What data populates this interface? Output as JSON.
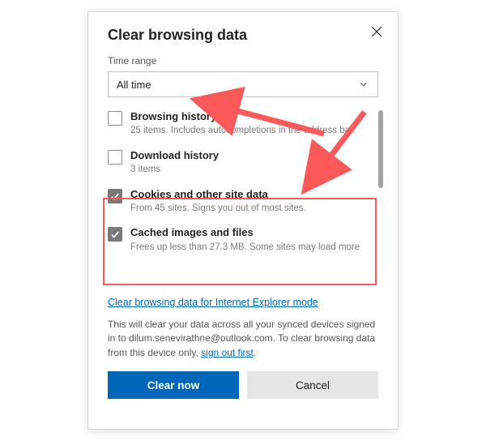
{
  "dialog": {
    "title": "Clear browsing data",
    "close_icon": "close"
  },
  "time_range": {
    "label": "Time range",
    "value": "All time"
  },
  "items": [
    {
      "checked": false,
      "title": "Browsing history",
      "desc": "25 items. Includes autocompletions in the address bar."
    },
    {
      "checked": false,
      "title": "Download history",
      "desc": "3 items"
    },
    {
      "checked": true,
      "title": "Cookies and other site data",
      "desc": "From 45 sites. Signs you out of most sites."
    },
    {
      "checked": true,
      "title": "Cached images and files",
      "desc": "Frees up less than 27.3 MB. Some sites may load more"
    }
  ],
  "ie_link": "Clear browsing data for Internet Explorer mode",
  "notice": {
    "pre": "This will clear your data across all your synced devices signed in to ",
    "email": "dilum.senevirathne@outlook.com",
    "mid": ". To clear browsing data from this device only, ",
    "link": "sign out first",
    "post": "."
  },
  "buttons": {
    "primary": "Clear now",
    "secondary": "Cancel"
  },
  "colors": {
    "accent": "#0067b8",
    "annotation": "#fc5a5a"
  }
}
